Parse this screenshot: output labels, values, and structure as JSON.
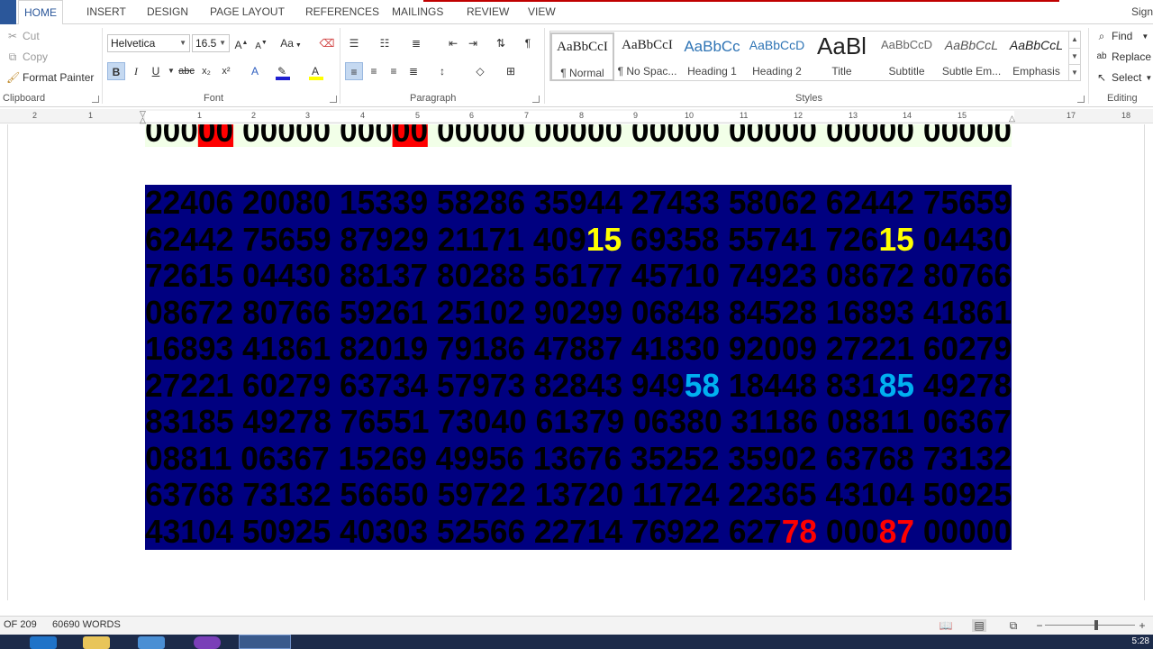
{
  "ribbon_tabs": [
    "HOME",
    "INSERT",
    "DESIGN",
    "PAGE LAYOUT",
    "REFERENCES",
    "MAILINGS",
    "REVIEW",
    "VIEW"
  ],
  "sign_in": "Sign",
  "clipboard": {
    "cut": "Cut",
    "copy": "Copy",
    "format_painter": "Format Painter",
    "label": "Clipboard"
  },
  "font": {
    "name": "Helvetica",
    "size": "16.5",
    "label": "Font",
    "change_case": "Aa"
  },
  "paragraph": {
    "label": "Paragraph"
  },
  "styles": {
    "label": "Styles",
    "items": [
      {
        "preview": "AaBbCcI",
        "name": "¶ Normal"
      },
      {
        "preview": "AaBbCcI",
        "name": "¶ No Spac..."
      },
      {
        "preview": "AaBbCc",
        "name": "Heading 1"
      },
      {
        "preview": "AaBbCcD",
        "name": "Heading 2"
      },
      {
        "preview": "AaBl",
        "name": "Title"
      },
      {
        "preview": "AaBbCcD",
        "name": "Subtitle"
      },
      {
        "preview": "AaBbCcL",
        "name": "Subtle Em..."
      },
      {
        "preview": "AaBbCcL",
        "name": "Emphasis"
      }
    ]
  },
  "editing": {
    "find": "Find",
    "replace": "Replace",
    "select": "Select",
    "label": "Editing"
  },
  "ruler_numbers": [
    "2",
    "1",
    "1",
    "2",
    "3",
    "4",
    "5",
    "6",
    "7",
    "8",
    "9",
    "10",
    "11",
    "12",
    "13",
    "14",
    "15",
    "17",
    "18"
  ],
  "document": {
    "top_line": [
      {
        "t": "000",
        "c": ""
      },
      {
        "t": "00",
        "c": "hl-red"
      },
      {
        "t": " 00000 000",
        "c": ""
      },
      {
        "t": "00",
        "c": "hl-red"
      },
      {
        "t": " 00000 00000 00000 00000 00000 00000",
        "c": ""
      }
    ],
    "lines": [
      [
        {
          "t": "22406 20080 15339 58286 35944 27433 58062 62442 75659",
          "c": ""
        }
      ],
      [
        {
          "t": "62442 75659 87929 21171 409",
          "c": ""
        },
        {
          "t": "15",
          "c": "yel"
        },
        {
          "t": " 69358 55741 726",
          "c": ""
        },
        {
          "t": "15",
          "c": "yel"
        },
        {
          "t": " 04430",
          "c": ""
        }
      ],
      [
        {
          "t": "72615 04430 88137 80288 56177 45710 74923 08672 80766",
          "c": ""
        }
      ],
      [
        {
          "t": "08672 80766 59261 25102 90299 06848 84528 16893 41861",
          "c": ""
        }
      ],
      [
        {
          "t": "16893 41861 82019 79186 47887 41830 92009 27221 60279",
          "c": ""
        }
      ],
      [
        {
          "t": "27221 60279 63734 57973 82843 949",
          "c": ""
        },
        {
          "t": "58",
          "c": "cyan"
        },
        {
          "t": " 18448 831",
          "c": ""
        },
        {
          "t": "85",
          "c": "cyan"
        },
        {
          "t": " 49278",
          "c": ""
        }
      ],
      [
        {
          "t": "83185 49278 76551 73040 61379 06380 31186 08811 06367",
          "c": ""
        }
      ],
      [
        {
          "t": "08811 06367 15269 49956 13676 35252 35902 63768 73132",
          "c": ""
        }
      ],
      [
        {
          "t": "63768 73132 56650 59722 13720 11724 22365 43104 50925",
          "c": ""
        }
      ],
      [
        {
          "t": "43104 50925 40303 52566 22714 76922 627",
          "c": ""
        },
        {
          "t": "78",
          "c": "red"
        },
        {
          "t": " 000",
          "c": ""
        },
        {
          "t": "87",
          "c": "red"
        },
        {
          "t": " 00000",
          "c": ""
        }
      ]
    ]
  },
  "status": {
    "page": "OF 209",
    "words": "60690 WORDS"
  },
  "clock": "5:28"
}
